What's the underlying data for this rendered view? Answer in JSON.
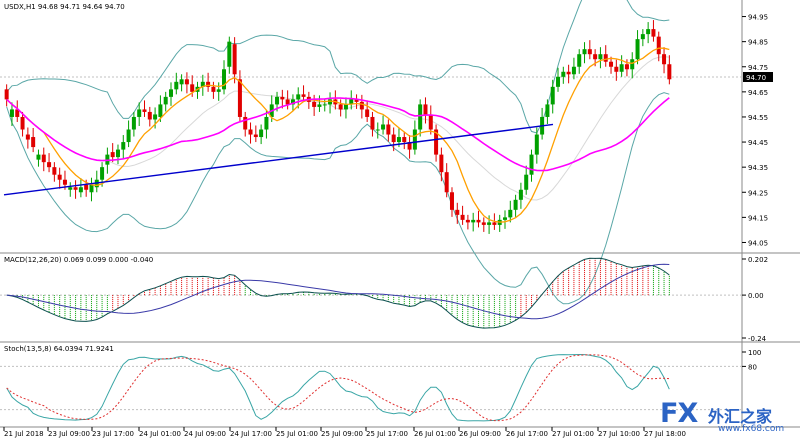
{
  "chart_data": {
    "type": "candlestick",
    "symbol_line": "USDX,H1  94.68 94.71 94.64 94.70",
    "price_axis": {
      "ticks": [
        "94.95",
        "94.85",
        "94.75",
        "94.65",
        "94.55",
        "94.45",
        "94.35",
        "94.25",
        "94.15",
        "94.05"
      ],
      "last_price": "94.70",
      "range": [
        94.02,
        95.0
      ]
    },
    "time_axis": [
      "21 Jul 2018",
      "23 Jul 09:00",
      "23 Jul 17:00",
      "24 Jul 01:00",
      "24 Jul 09:00",
      "24 Jul 17:00",
      "25 Jul 01:00",
      "25 Jul 09:00",
      "25 Jul 17:00",
      "26 Jul 01:00",
      "26 Jul 09:00",
      "26 Jul 17:00",
      "27 Jul 01:00",
      "27 Jul 10:00",
      "27 Jul 18:00"
    ],
    "close": [
      94.62,
      94.58,
      94.55,
      94.5,
      94.46,
      94.43,
      94.4,
      94.37,
      94.35,
      94.32,
      94.3,
      94.28,
      94.27,
      94.26,
      94.27,
      94.26,
      94.28,
      94.3,
      94.35,
      94.4,
      94.39,
      94.42,
      94.45,
      94.5,
      94.55,
      94.58,
      94.57,
      94.54,
      94.56,
      94.6,
      94.63,
      94.66,
      94.69,
      94.7,
      94.68,
      94.65,
      94.67,
      94.69,
      94.67,
      94.65,
      94.66,
      94.74,
      94.85,
      94.72,
      94.55,
      94.5,
      94.48,
      94.47,
      94.5,
      94.55,
      94.6,
      94.63,
      94.62,
      94.6,
      94.62,
      94.64,
      94.63,
      94.61,
      94.59,
      94.6,
      94.6,
      94.62,
      94.6,
      94.58,
      94.6,
      94.62,
      94.61,
      94.58,
      94.55,
      94.5,
      94.5,
      94.52,
      94.48,
      94.45,
      94.47,
      94.45,
      94.42,
      94.5,
      94.6,
      94.56,
      94.5,
      94.4,
      94.33,
      94.25,
      94.18,
      94.16,
      94.14,
      94.13,
      94.14,
      94.13,
      94.12,
      94.13,
      94.12,
      94.14,
      94.15,
      94.18,
      94.22,
      94.26,
      94.32,
      94.4,
      94.48,
      94.55,
      94.6,
      94.67,
      94.71,
      94.73,
      94.72,
      94.75,
      94.8,
      94.82,
      94.8,
      94.78,
      94.8,
      94.77,
      94.75,
      94.73,
      94.76,
      94.74,
      94.78,
      94.86,
      94.88,
      94.9,
      94.87,
      94.8,
      94.76,
      94.7
    ],
    "open_offsets": [
      0.04,
      -0.03,
      0.03,
      0.05,
      0.02,
      0.04,
      -0.02,
      0.03,
      0.02,
      0.03,
      0.02,
      0.02,
      -0.01,
      0.01,
      -0.02,
      0.02,
      -0.03,
      -0.03,
      -0.05,
      -0.04,
      0.02,
      -0.03,
      -0.03,
      -0.05,
      -0.05,
      -0.03,
      0.01,
      0.03,
      -0.02,
      -0.05,
      -0.03,
      -0.03,
      -0.03,
      -0.02,
      0.02,
      0.03,
      -0.02,
      -0.02,
      0.02,
      0.02,
      -0.01,
      -0.08,
      -0.1,
      0.12,
      0.15,
      0.05,
      0.02,
      0.01,
      -0.03,
      -0.05,
      -0.05,
      -0.03,
      0.01,
      0.02,
      -0.02,
      -0.02,
      0.01,
      0.02,
      0.02,
      -0.01,
      0.0,
      -0.02,
      0.02,
      0.02,
      -0.02,
      -0.02,
      0.01,
      0.03,
      0.03,
      0.05,
      0.0,
      -0.02,
      0.04,
      0.03,
      -0.02,
      0.02,
      0.03,
      -0.08,
      -0.1,
      0.04,
      0.06,
      0.1,
      0.07,
      0.08,
      0.07,
      0.02,
      0.02,
      0.01,
      -0.01,
      0.01,
      0.01,
      -0.01,
      0.01,
      -0.02,
      -0.01,
      -0.03,
      -0.04,
      -0.04,
      -0.06,
      -0.08,
      -0.08,
      -0.07,
      -0.05,
      -0.07,
      -0.04,
      -0.02,
      0.01,
      -0.03,
      -0.05,
      -0.02,
      0.02,
      0.02,
      -0.02,
      0.03,
      0.02,
      0.02,
      -0.03,
      0.02,
      -0.04,
      -0.08,
      -0.02,
      -0.02,
      0.03,
      0.07,
      0.04,
      0.06
    ],
    "indicators": {
      "macd_label": "MACD(12,26,20) 0.069 0.099 0.000 -0.040",
      "macd_ticks": [
        "0.202",
        "0.00",
        "-0.24"
      ],
      "stoch_label": "Stoch(13,5,8) 64.0394 71.9241",
      "stoch_ticks": [
        "100",
        "80"
      ]
    },
    "trendline": {
      "from": [
        "21 Jul 2018",
        94.24
      ],
      "to": [
        "27 Jul 01:00",
        94.52
      ]
    }
  },
  "watermark": {
    "brand": "FX",
    "cn": "外汇之家",
    "url": "www.fx68.com"
  },
  "colors": {
    "bull": "#00a000",
    "bear": "#e00000",
    "bb": "#5aa7a7",
    "ma_fast": "#ffa000",
    "ma_slow": "#ff00ff",
    "trend": "#0000cc",
    "grid": "#c8c8c8"
  }
}
